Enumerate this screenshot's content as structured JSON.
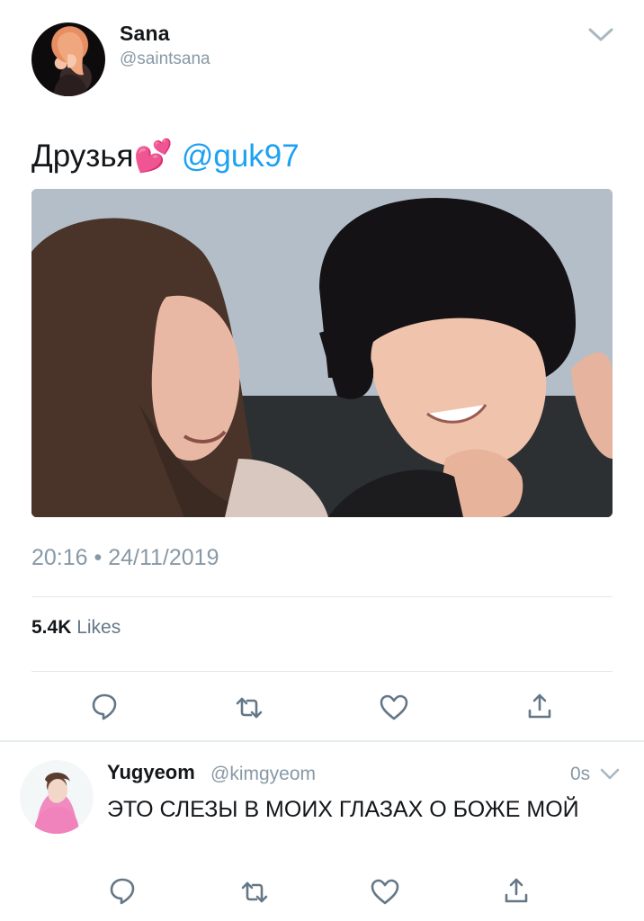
{
  "tweet": {
    "author_name": "Sana",
    "author_handle": "@saintsana",
    "text_prefix": "Друзья💕",
    "mention": "@guk97",
    "timestamp": "20:16 • 24/11/2019",
    "likes_count": "5.4K",
    "likes_label": "Likes",
    "avatar_icon": "profile-avatar",
    "photo_icon": "tweet-photo"
  },
  "actions": [
    "reply-icon",
    "retweet-icon",
    "like-icon",
    "share-icon"
  ],
  "reply": {
    "author_name": "Yugyeom",
    "author_handle": "@kimgyeom",
    "time": "0s",
    "text": "ЭТО СЛЕЗЫ В МОИХ ГЛАЗАХ О БОЖЕ МОЙ"
  },
  "colors": {
    "accent": "#1da1f2",
    "secondary_text": "#8899a6",
    "icon": "#657786",
    "divider": "#e1e8ed"
  }
}
